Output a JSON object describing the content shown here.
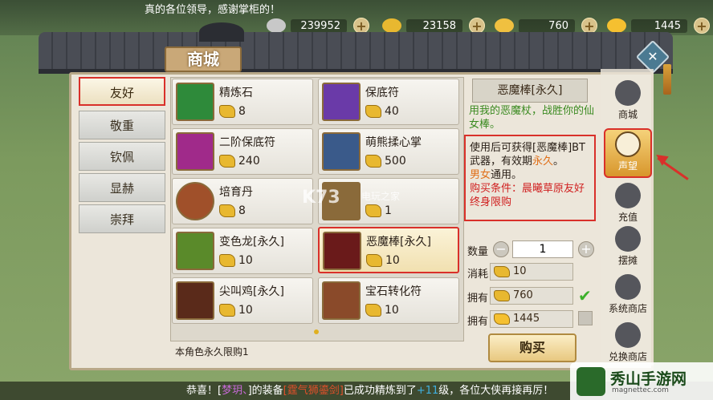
{
  "top_notice": "真的各位领导，感谢掌柜的！",
  "resources": [
    {
      "icon": "silver-coin-icon",
      "value": "239952",
      "color": "#c8c8c8"
    },
    {
      "icon": "gold-ingot-icon",
      "value": "23158",
      "color": "#e8b830"
    },
    {
      "icon": "gift-ingot-icon",
      "value": "760",
      "color": "#f0c040"
    },
    {
      "icon": "yuanbao-icon",
      "value": "1445",
      "color": "#f5c030"
    }
  ],
  "shop_title": "商城",
  "categories": [
    "友好",
    "敬重",
    "钦佩",
    "显赫",
    "崇拜"
  ],
  "active_category_index": 0,
  "items": [
    {
      "name": "精炼石",
      "price": "8",
      "thumb_color": "#2e8a3a"
    },
    {
      "name": "保底符",
      "price": "40",
      "thumb_color": "#6a3aa8"
    },
    {
      "name": "二阶保底符",
      "price": "240",
      "thumb_color": "#a02a8a"
    },
    {
      "name": "萌熊揉心掌",
      "price": "500",
      "thumb_color": "#3a5a8a"
    },
    {
      "name": "培育丹",
      "price": "8",
      "thumb_color": "#a0502a"
    },
    {
      "name": "",
      "price": "1",
      "thumb_color": "#8a6a3a"
    },
    {
      "name": "变色龙[永久]",
      "price": "10",
      "thumb_color": "#5a8a2a"
    },
    {
      "name": "恶魔棒[永久]",
      "price": "10",
      "thumb_color": "#6a1a1a"
    },
    {
      "name": "尖叫鸡[永久]",
      "price": "10",
      "thumb_color": "#5a2a1a"
    },
    {
      "name": "宝石转化符",
      "price": "10",
      "thumb_color": "#8a4a2a"
    }
  ],
  "selected_item_index": 7,
  "footnote": "本角色永久限购1",
  "detail": {
    "title": "恶魔棒[永久]",
    "subtitle": "用我的恶魔杖，战胜你的仙女棒。",
    "desc_part1": "使用后可获得[恶魔棒]BT武器，有效期",
    "desc_duration": "永久",
    "desc_part2": "。",
    "desc_gender": "男女",
    "desc_gender_suffix": "通用。",
    "desc_condition": "购买条件：晨曦草原友好终身限购"
  },
  "purchase": {
    "qty_label": "数量",
    "qty_value": "1",
    "cost_label": "消耗",
    "cost_value": "10",
    "own_label": "拥有",
    "own_value_1": "760",
    "own_value_2": "1445",
    "buy_label": "购买"
  },
  "nav": [
    {
      "label": "商城",
      "icon": "bag-icon"
    },
    {
      "label": "声望",
      "icon": "reputation-icon"
    },
    {
      "label": "充值",
      "icon": "cloud-icon"
    },
    {
      "label": "摆摊",
      "icon": "stall-icon"
    },
    {
      "label": "系统商店",
      "icon": "house-icon"
    },
    {
      "label": "兑换商店",
      "icon": "exchange-icon"
    }
  ],
  "active_nav_index": 1,
  "bottom_notice": {
    "prefix": "恭喜！[",
    "player": "梦玥、",
    "mid1": "]的装备",
    "item": "[霆气狮鎏剑]",
    "mid2": "已成功精炼到了",
    "level": "+11",
    "suffix": "级，各位大侠再接再厉！"
  },
  "watermark": {
    "brand": "秀山手游网",
    "url": "magnettec.com"
  },
  "overlay_logo": {
    "text": "K73",
    "sub": "电玩之家"
  }
}
